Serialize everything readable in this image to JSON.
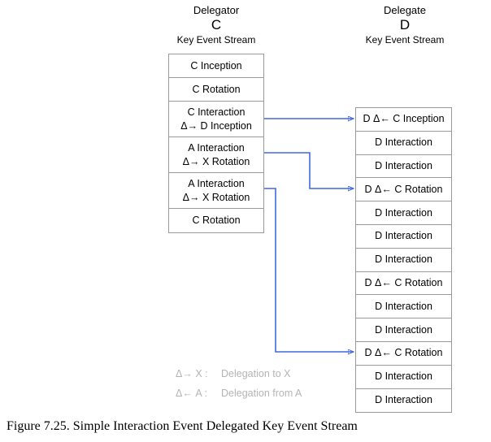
{
  "figure": {
    "caption": "Figure 7.25.  Simple Interaction Event Delegated Key Event Stream"
  },
  "delegator": {
    "role": "Delegator",
    "letter": "C",
    "stream_label": "Key Event Stream",
    "rows": [
      {
        "lines": [
          "C Inception"
        ]
      },
      {
        "lines": [
          "C Rotation"
        ]
      },
      {
        "lines": [
          "C Interaction",
          "Δ→ D Inception"
        ]
      },
      {
        "lines": [
          "A Interaction",
          "Δ→ X Rotation"
        ]
      },
      {
        "lines": [
          "A Interaction",
          "Δ→ X Rotation"
        ]
      },
      {
        "lines": [
          "C Rotation"
        ]
      }
    ]
  },
  "delegate": {
    "role": "Delegate",
    "letter": "D",
    "stream_label": "Key Event Stream",
    "rows": [
      {
        "lines": [
          "D Δ← C Inception"
        ]
      },
      {
        "lines": [
          "D Interaction"
        ]
      },
      {
        "lines": [
          "D Interaction"
        ]
      },
      {
        "lines": [
          "D Δ← C Rotation"
        ]
      },
      {
        "lines": [
          "D Interaction"
        ]
      },
      {
        "lines": [
          "D Interaction"
        ]
      },
      {
        "lines": [
          "D Interaction"
        ]
      },
      {
        "lines": [
          "D Δ← C Rotation"
        ]
      },
      {
        "lines": [
          "D Interaction"
        ]
      },
      {
        "lines": [
          "D Interaction"
        ]
      },
      {
        "lines": [
          "D Δ← C Rotation"
        ]
      },
      {
        "lines": [
          "D Interaction"
        ]
      },
      {
        "lines": [
          "D Interaction"
        ]
      }
    ]
  },
  "legend": [
    {
      "symbol": "Δ→ X :",
      "description": "Delegation to X"
    },
    {
      "symbol": "Δ← A :",
      "description": "Delegation from A"
    }
  ],
  "colors": {
    "connector": "#4169e1",
    "box_border": "#9a9a9a",
    "text": "#000000",
    "legend_text": "#b4b4b4",
    "background": "#ffffff"
  },
  "connectors": [
    {
      "name": "c-interaction-to-d-inception",
      "from_row": 2,
      "to_row": 0
    },
    {
      "name": "a-interaction-1-to-d-rotation-1",
      "from_row": 3,
      "to_row": 3
    },
    {
      "name": "a-interaction-2-to-d-rotation-3",
      "from_row": 4,
      "to_row": 10
    }
  ]
}
